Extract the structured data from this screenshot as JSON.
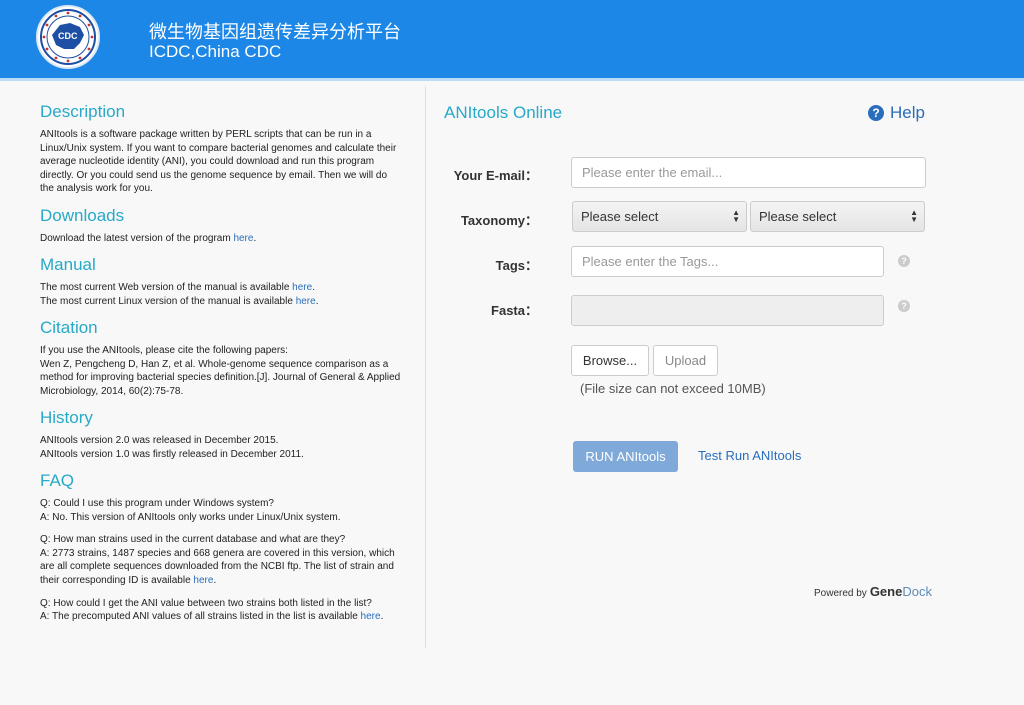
{
  "header": {
    "title_cn": "微生物基因组遗传差异分析平台",
    "title_en": "ICDC,China CDC",
    "logo_text": "CDC"
  },
  "left": {
    "description": {
      "heading": "Description",
      "text": "ANItools is a software package written by PERL scripts that can be run in a Linux/Unix system. If you want to compare bacterial genomes and calculate their average nucleotide identity (ANI), you could download and run this program directly. Or you could send us the genome sequence by email. Then we will do the analysis work for you."
    },
    "downloads": {
      "heading": "Downloads",
      "text": "Download the latest version of the program ",
      "link": "here",
      "tail": "."
    },
    "manual": {
      "heading": "Manual",
      "web_text": "The most current Web version of the manual is available ",
      "web_link": "here",
      "linux_text": "The most current Linux version of the manual is available ",
      "linux_link": "here",
      "tail": "."
    },
    "citation": {
      "heading": "Citation",
      "line1": "If you use the ANItools, please cite the following papers:",
      "line2": "Wen Z, Pengcheng D, Han Z, et al. Whole-genome sequence comparison as a method for improving bacterial species definition.[J]. Journal of General & Applied Microbiology, 2014, 60(2):75-78."
    },
    "history": {
      "heading": "History",
      "line1": "ANItools version 2.0 was released in December 2015.",
      "line2": "ANItools version 1.0 was firstly released in December 2011."
    },
    "faq": {
      "heading": "FAQ",
      "q1": "Q: Could I use this program under Windows system?",
      "a1": "A: No. This version of ANItools only works under Linux/Unix system.",
      "q2": "Q: How man strains used in the current database and what are they?",
      "a2": "A: 2773 strains, 1487 species and 668 genera are covered in this version, which are all complete sequences downloaded from the NCBI ftp. The list of strain and their corresponding ID is available ",
      "a2_link": "here",
      "q3": "Q: How could I get the ANI value between two strains both listed in the list?",
      "a3": "A: The precomputed ANI values of all strains listed in the list is available ",
      "a3_link": "here",
      "tail": "."
    }
  },
  "right": {
    "title": "ANItools Online",
    "help_label": "Help",
    "help_icon": "?",
    "email_label": "Your E-mail：",
    "email_placeholder": "Please enter the email...",
    "taxonomy_label": "Taxonomy：",
    "taxonomy_select1": "Please select",
    "taxonomy_select2": "Please select",
    "tags_label": "Tags：",
    "tags_placeholder": "Please enter the Tags...",
    "fasta_label": "Fasta：",
    "question_mark": "?",
    "browse_label": "Browse...",
    "upload_label": "Upload",
    "file_hint": "(File size can not exceed 10MB)",
    "run_label": "RUN ANItools",
    "test_run_label": "Test Run ANItools",
    "powered_by": "Powered by",
    "brand_part1": "Gene",
    "brand_part2": "Dock"
  }
}
